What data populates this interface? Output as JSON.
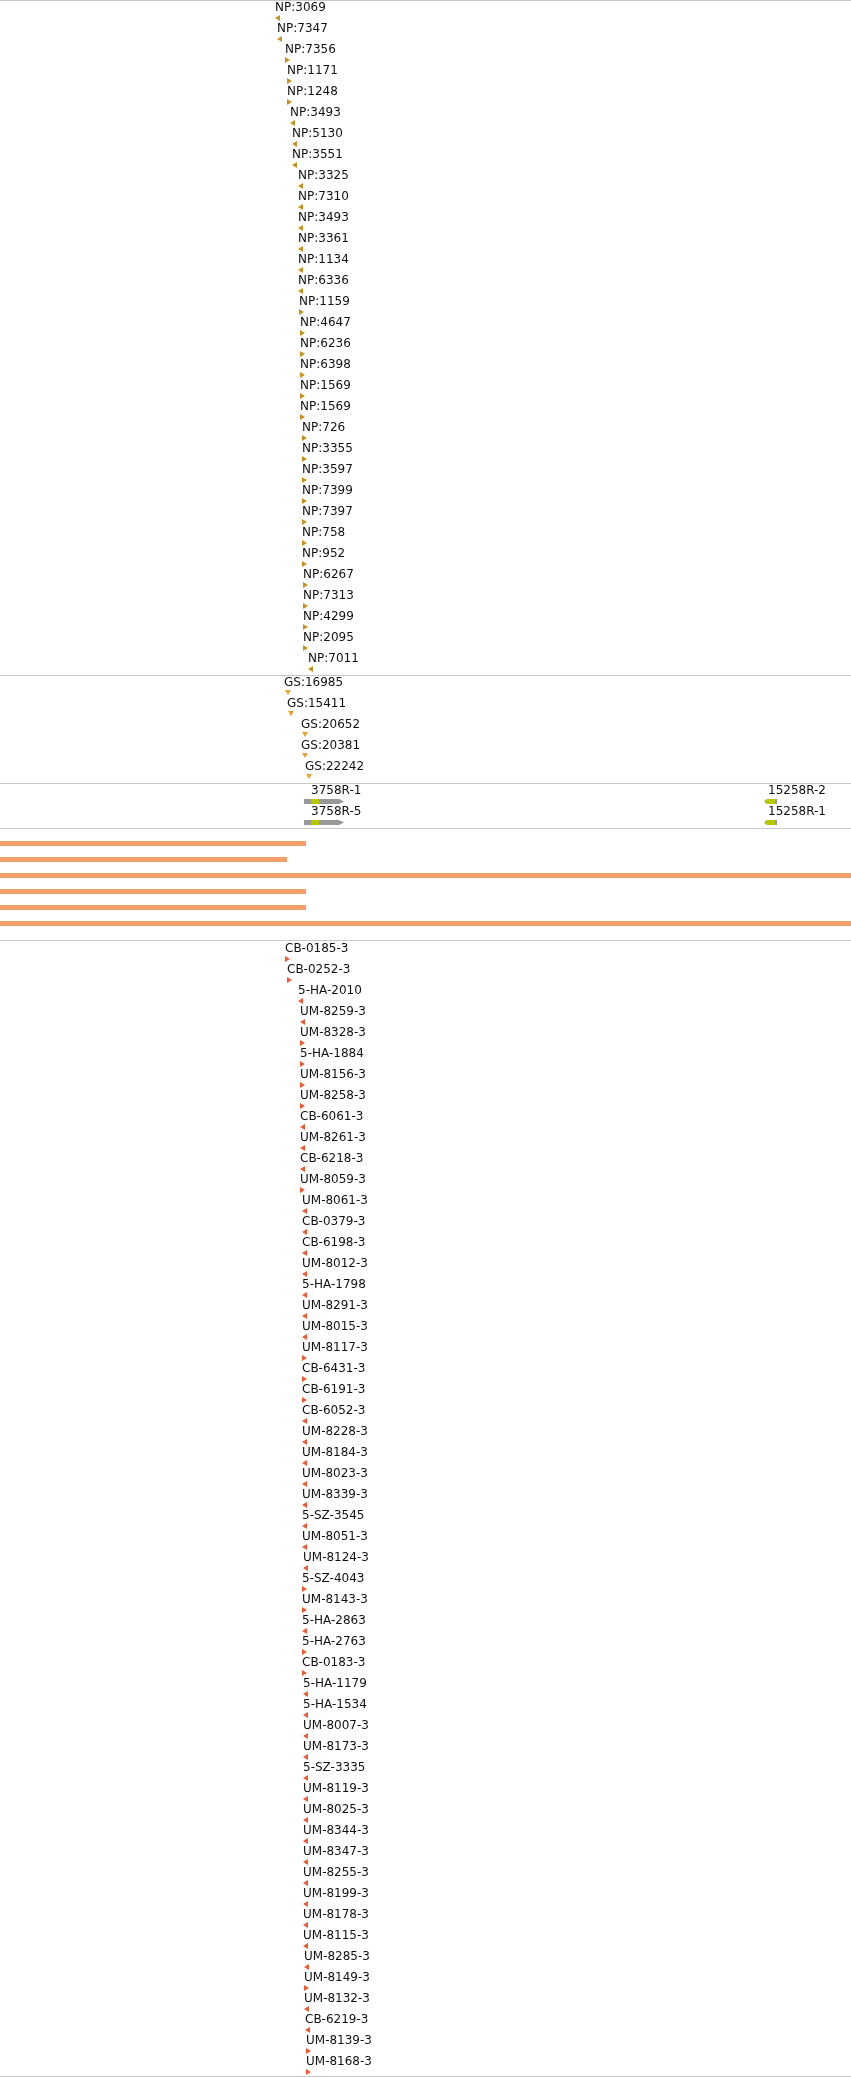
{
  "np_track": {
    "features": [
      {
        "label": "NP:3069",
        "reverse": true
      },
      {
        "label": "NP:7347",
        "reverse": true
      },
      {
        "label": "NP:7356",
        "reverse": false
      },
      {
        "label": "NP:1171",
        "reverse": false
      },
      {
        "label": "NP:1248",
        "reverse": false
      },
      {
        "label": "NP:3493",
        "reverse": true
      },
      {
        "label": "NP:5130",
        "reverse": true
      },
      {
        "label": "NP:3551",
        "reverse": true
      },
      {
        "label": "NP:3325",
        "reverse": true
      },
      {
        "label": "NP:7310",
        "reverse": true
      },
      {
        "label": "NP:3493",
        "reverse": true
      },
      {
        "label": "NP:3361",
        "reverse": true
      },
      {
        "label": "NP:1134",
        "reverse": true
      },
      {
        "label": "NP:6336",
        "reverse": true
      },
      {
        "label": "NP:1159",
        "reverse": false
      },
      {
        "label": "NP:4647",
        "reverse": false
      },
      {
        "label": "NP:6236",
        "reverse": false
      },
      {
        "label": "NP:6398",
        "reverse": false
      },
      {
        "label": "NP:1569",
        "reverse": false
      },
      {
        "label": "NP:1569",
        "reverse": false
      },
      {
        "label": "NP:726",
        "reverse": false
      },
      {
        "label": "NP:3355",
        "reverse": false
      },
      {
        "label": "NP:3597",
        "reverse": false
      },
      {
        "label": "NP:7399",
        "reverse": false
      },
      {
        "label": "NP:7397",
        "reverse": false
      },
      {
        "label": "NP:758",
        "reverse": false
      },
      {
        "label": "NP:952",
        "reverse": false
      },
      {
        "label": "NP:6267",
        "reverse": false
      },
      {
        "label": "NP:7313",
        "reverse": false
      },
      {
        "label": "NP:4299",
        "reverse": false
      },
      {
        "label": "NP:2095",
        "reverse": false
      },
      {
        "label": "NP:7011",
        "reverse": true
      }
    ]
  },
  "gs_track": {
    "features": [
      {
        "label": "GS:16985"
      },
      {
        "label": "GS:15411"
      },
      {
        "label": "GS:20652"
      },
      {
        "label": "GS:20381"
      },
      {
        "label": "GS:22242"
      }
    ]
  },
  "gene_track": {
    "rows": [
      {
        "genes": [
          {
            "label": "3758R-1",
            "reverse": false
          },
          {
            "label": "15258R-2",
            "reverse": true
          }
        ]
      },
      {
        "genes": [
          {
            "label": "3758R-5",
            "reverse": false
          },
          {
            "label": "15258R-1",
            "reverse": true
          }
        ]
      }
    ]
  },
  "id_track": {
    "features": [
      {
        "label": "CB-0185-3",
        "reverse": false
      },
      {
        "label": "CB-0252-3",
        "reverse": false
      },
      {
        "label": "5-HA-2010",
        "reverse": true
      },
      {
        "label": "UM-8259-3",
        "reverse": true
      },
      {
        "label": "UM-8328-3",
        "reverse": false
      },
      {
        "label": "5-HA-1884",
        "reverse": false
      },
      {
        "label": "UM-8156-3",
        "reverse": false
      },
      {
        "label": "UM-8258-3",
        "reverse": false
      },
      {
        "label": "CB-6061-3",
        "reverse": true
      },
      {
        "label": "UM-8261-3",
        "reverse": true
      },
      {
        "label": "CB-6218-3",
        "reverse": true
      },
      {
        "label": "UM-8059-3",
        "reverse": false
      },
      {
        "label": "UM-8061-3",
        "reverse": true
      },
      {
        "label": "CB-0379-3",
        "reverse": true
      },
      {
        "label": "CB-6198-3",
        "reverse": true
      },
      {
        "label": "UM-8012-3",
        "reverse": true
      },
      {
        "label": "5-HA-1798",
        "reverse": true
      },
      {
        "label": "UM-8291-3",
        "reverse": true
      },
      {
        "label": "UM-8015-3",
        "reverse": true
      },
      {
        "label": "UM-8117-3",
        "reverse": false
      },
      {
        "label": "CB-6431-3",
        "reverse": false
      },
      {
        "label": "CB-6191-3",
        "reverse": false
      },
      {
        "label": "CB-6052-3",
        "reverse": true
      },
      {
        "label": "UM-8228-3",
        "reverse": true
      },
      {
        "label": "UM-8184-3",
        "reverse": true
      },
      {
        "label": "UM-8023-3",
        "reverse": true
      },
      {
        "label": "UM-8339-3",
        "reverse": true
      },
      {
        "label": "5-SZ-3545",
        "reverse": true
      },
      {
        "label": "UM-8051-3",
        "reverse": true
      },
      {
        "label": "UM-8124-3",
        "reverse": true
      },
      {
        "label": "5-SZ-4043",
        "reverse": false
      },
      {
        "label": "UM-8143-3",
        "reverse": false
      },
      {
        "label": "5-HA-2863",
        "reverse": true
      },
      {
        "label": "5-HA-2763",
        "reverse": false
      },
      {
        "label": "CB-0183-3",
        "reverse": false
      },
      {
        "label": "5-HA-1179",
        "reverse": true
      },
      {
        "label": "5-HA-1534",
        "reverse": true
      },
      {
        "label": "UM-8007-3",
        "reverse": true
      },
      {
        "label": "UM-8173-3",
        "reverse": true
      },
      {
        "label": "5-SZ-3335",
        "reverse": true
      },
      {
        "label": "UM-8119-3",
        "reverse": true
      },
      {
        "label": "UM-8025-3",
        "reverse": true
      },
      {
        "label": "UM-8344-3",
        "reverse": true
      },
      {
        "label": "UM-8347-3",
        "reverse": true
      },
      {
        "label": "UM-8255-3",
        "reverse": true
      },
      {
        "label": "UM-8199-3",
        "reverse": true
      },
      {
        "label": "UM-8178-3",
        "reverse": true
      },
      {
        "label": "UM-8115-3",
        "reverse": true
      },
      {
        "label": "UM-8285-3",
        "reverse": true
      },
      {
        "label": "UM-8149-3",
        "reverse": false
      },
      {
        "label": "UM-8132-3",
        "reverse": true
      },
      {
        "label": "CB-6219-3",
        "reverse": true
      },
      {
        "label": "UM-8139-3",
        "reverse": false
      },
      {
        "label": "UM-8168-3",
        "reverse": false
      }
    ]
  }
}
